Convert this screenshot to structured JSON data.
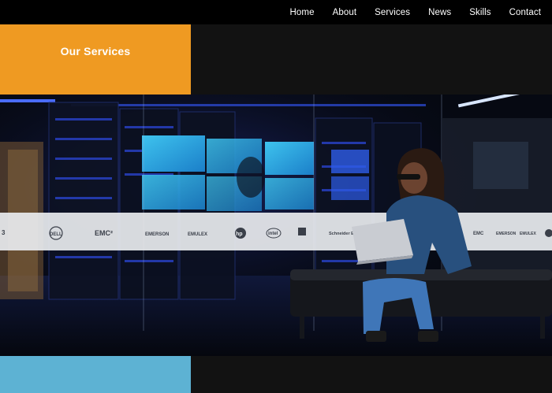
{
  "nav": {
    "items": [
      {
        "label": "Home"
      },
      {
        "label": "About"
      },
      {
        "label": "Services"
      },
      {
        "label": "News"
      },
      {
        "label": "Skills"
      },
      {
        "label": "Contact"
      }
    ]
  },
  "services_section": {
    "title": "Our Services"
  },
  "hero": {
    "logos": [
      "DELL",
      "EMC²",
      "EMERSON",
      "EMULEX",
      "hp",
      "intel",
      "Schneider Electric",
      "EMC",
      "EMERSON",
      "EMULEX"
    ]
  },
  "colors": {
    "accent_orange": "#ef9a22",
    "accent_blue": "#5db2d3",
    "nav_bg": "#000000",
    "panel_dark": "#121212"
  }
}
